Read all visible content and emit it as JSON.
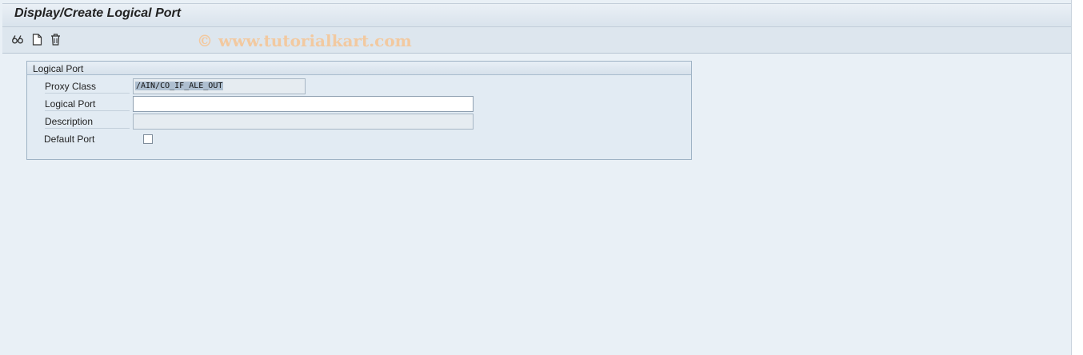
{
  "window": {
    "title": "Display/Create Logical Port"
  },
  "toolbar": {
    "icons": [
      "glasses-icon",
      "new-document-icon",
      "trash-icon"
    ],
    "watermark": "© www.tutorialkart.com"
  },
  "group": {
    "title": "Logical Port",
    "fields": {
      "proxy_class": {
        "label": "Proxy Class",
        "value": "/AIN/CO_IF_ALE_OUT"
      },
      "logical_port": {
        "label": "Logical Port",
        "value": ""
      },
      "description": {
        "label": "Description",
        "value": ""
      },
      "default_port": {
        "label": "Default Port",
        "checked": false
      }
    }
  }
}
